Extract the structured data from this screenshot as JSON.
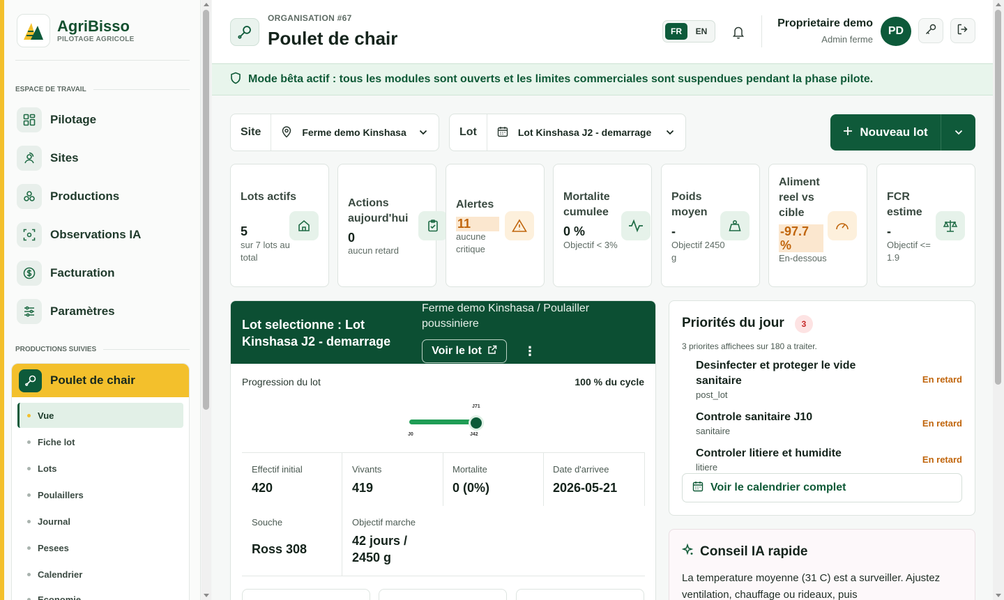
{
  "brand": {
    "name": "AgriBisso",
    "tagline": "PILOTAGE AGRICOLE"
  },
  "sidebar": {
    "workspace_label": "ESPACE DE TRAVAIL",
    "items": [
      {
        "label": "Pilotage",
        "icon": "dashboard-icon"
      },
      {
        "label": "Sites",
        "icon": "location-user-icon"
      },
      {
        "label": "Productions",
        "icon": "cubes-icon"
      },
      {
        "label": "Observations IA",
        "icon": "scan-icon"
      },
      {
        "label": "Facturation",
        "icon": "dollar-icon"
      },
      {
        "label": "Paramètres",
        "icon": "sliders-icon"
      }
    ],
    "followed_label": "PRODUCTIONS SUIVIES",
    "production": {
      "label": "Poulet de chair",
      "items": [
        "Vue",
        "Fiche lot",
        "Lots",
        "Poulaillers",
        "Journal",
        "Pesees",
        "Calendrier",
        "Economie"
      ],
      "active": "Vue"
    }
  },
  "header": {
    "org": "ORGANISATION #67",
    "title": "Poulet de chair",
    "lang": {
      "fr": "FR",
      "en": "EN",
      "active": "FR"
    },
    "user": {
      "name": "Proprietaire demo",
      "role": "Admin ferme",
      "initials": "PD"
    }
  },
  "beta_notice": "Mode bêta actif : tous les modules sont ouverts et les limites commerciales sont suspendues pendant la phase pilote.",
  "filters": {
    "site": {
      "label": "Site",
      "value": "Ferme demo Kinshasa"
    },
    "lot": {
      "label": "Lot",
      "value": "Lot Kinshasa J2 - demarrage"
    },
    "new_lot": "Nouveau lot"
  },
  "kpis": [
    {
      "title": "Lots actifs",
      "value": "5",
      "sub": "sur 7 lots au total",
      "icon": "house-icon",
      "tone": "green"
    },
    {
      "title": "Actions aujourd'hui",
      "value": "0",
      "sub": "aucun retard",
      "icon": "clipboard-check-icon",
      "tone": "green"
    },
    {
      "title": "Alertes",
      "value": "11",
      "sub": "aucune critique",
      "icon": "warning-icon",
      "tone": "orange"
    },
    {
      "title": "Mortalite cumulee",
      "value": "0 %",
      "sub": "Objectif < 3%",
      "icon": "pulse-icon",
      "tone": "green"
    },
    {
      "title": "Poids moyen",
      "value": "-",
      "sub": "Objectif 2450 g",
      "icon": "weight-icon",
      "tone": "green"
    },
    {
      "title": "Aliment reel vs cible",
      "value": "-97.7 %",
      "sub": "En-dessous",
      "icon": "gauge-icon",
      "tone": "orange"
    },
    {
      "title": "FCR estime",
      "value": "-",
      "sub": "Objectif <= 1.9",
      "icon": "scale-icon",
      "tone": "green"
    }
  ],
  "lot_panel": {
    "title": "Lot selectionne : Lot Kinshasa J2 - demarrage",
    "location": "Ferme demo Kinshasa / Poulailler poussiniere",
    "view_button": "Voir le lot",
    "progress_label": "Progression du lot",
    "progress_value": "100 % du cycle",
    "progress_fraction": 1.0,
    "ticks": {
      "start": "J0",
      "current": "J42",
      "end": "J71"
    },
    "stats": [
      {
        "label": "Effectif initial",
        "value": "420"
      },
      {
        "label": "Vivants",
        "value": "419"
      },
      {
        "label": "Mortalite",
        "value": "0 (0%)"
      },
      {
        "label": "Date d'arrivee",
        "value": "2026-05-21"
      },
      {
        "label": "Souche",
        "value": "Ross 308"
      },
      {
        "label": "Objectif marche",
        "value": "42 jours / 2450 g"
      }
    ]
  },
  "priorities": {
    "title": "Priorités du jour",
    "count": "3",
    "subtitle": "3 priorites affichees sur 180 a traiter.",
    "items": [
      {
        "title": "Desinfecter et proteger le vide sanitaire",
        "category": "post_lot",
        "status": "En retard"
      },
      {
        "title": "Controle sanitaire J10",
        "category": "sanitaire",
        "status": "En retard"
      },
      {
        "title": "Controler litiere et humidite",
        "category": "litiere",
        "status": "En retard"
      }
    ],
    "calendar_button": "Voir le calendrier complet"
  },
  "ia_tip": {
    "title": "Conseil IA rapide",
    "text": "La temperature moyenne (31 C) est a surveiller. Ajustez ventilation, chauffage ou rideaux, puis"
  },
  "colors": {
    "primary": "#0d5a3a",
    "accent": "#f3c02c",
    "warning": "#c0650c",
    "beta_bg": "#e8f5ec"
  }
}
